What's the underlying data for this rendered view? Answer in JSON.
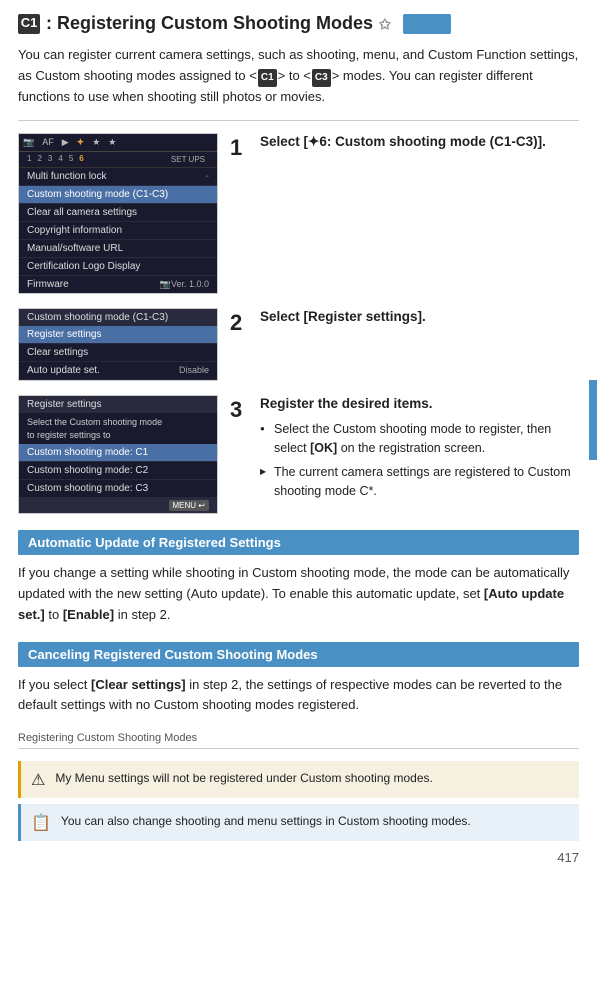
{
  "page": {
    "title_prefix": ": Registering Custom Shooting Modes",
    "title_star": "✩",
    "page_number": "417"
  },
  "intro": {
    "text": "You can register current camera settings, such as shooting, menu, and Custom Function settings, as Custom shooting modes assigned to <",
    "c1_label": "C1",
    "middle": "> to <",
    "c3_label": "C3",
    "end": "> modes. You can register different functions to use when shooting still photos or movies."
  },
  "steps": [
    {
      "number": "1",
      "title": "Select [✦6: Custom shooting mode (C1-C3)].",
      "has_desc": false
    },
    {
      "number": "2",
      "title": "Select [Register settings].",
      "has_desc": false
    },
    {
      "number": "3",
      "title": "Register the desired items.",
      "desc_bullets": [
        {
          "type": "bullet",
          "text": "Select the Custom shooting mode to register, then select [OK] on the registration screen."
        },
        {
          "type": "arrow",
          "text": "The current camera settings are registered to Custom shooting mode C*."
        }
      ]
    }
  ],
  "cam_screen_1": {
    "tabs": [
      "📷",
      "AF",
      "▶",
      "✦",
      "★",
      "★"
    ],
    "numbers": [
      "1",
      "2",
      "3",
      "4",
      "5",
      "6"
    ],
    "active_number": "6",
    "setup_label": "SET UPS",
    "items": [
      {
        "label": "Multi function lock",
        "value": "-",
        "highlighted": false
      },
      {
        "label": "Custom shooting mode (C1-C3)",
        "value": "",
        "highlighted": true
      },
      {
        "label": "Clear all camera settings",
        "value": "",
        "highlighted": false
      },
      {
        "label": "Copyright information",
        "value": "",
        "highlighted": false
      },
      {
        "label": "Manual/software URL",
        "value": "",
        "highlighted": false
      },
      {
        "label": "Certification Logo Display",
        "value": "",
        "highlighted": false
      },
      {
        "label": "Firmware",
        "value": "📷Ver. 1.0.0",
        "highlighted": false
      }
    ]
  },
  "cam_screen_2": {
    "header": "Custom shooting mode (C1-C3)",
    "items": [
      {
        "label": "Register settings",
        "value": "",
        "highlighted": true
      },
      {
        "label": "Clear settings",
        "value": "",
        "highlighted": false
      },
      {
        "label": "Auto update set.",
        "value": "Disable",
        "highlighted": false
      }
    ]
  },
  "cam_screen_3": {
    "header": "Register settings",
    "sub_desc": "Select the Custom shooting mode\nto register settings to",
    "items": [
      {
        "label": "Custom shooting mode: C1",
        "highlighted": true
      },
      {
        "label": "Custom shooting mode: C2",
        "highlighted": false
      },
      {
        "label": "Custom shooting mode: C3",
        "highlighted": false
      }
    ],
    "menu_label": "MENU"
  },
  "sections": [
    {
      "id": "auto-update",
      "header": "Automatic Update of Registered Settings",
      "text": "If you change a setting while shooting in Custom shooting mode, the mode can be automatically updated with the new setting (Auto update). To enable this automatic update, set [Auto update set.] to [Enable] in step 2.",
      "bold_parts": [
        "[Auto update set.]",
        "[Enable]"
      ]
    },
    {
      "id": "canceling",
      "header": "Canceling Registered Custom Shooting Modes",
      "text": "If you select [Clear settings] in step 2, the settings of respective modes can be reverted to the default settings with no Custom shooting modes registered.",
      "bold_parts": [
        "[Clear settings]"
      ]
    }
  ],
  "breadcrumb": "Registering Custom Shooting Modes",
  "notes": [
    {
      "type": "warning",
      "icon": "⚠",
      "text": "My Menu settings will not be registered under Custom shooting modes."
    },
    {
      "type": "info",
      "icon": "📋",
      "text": "You can also change shooting and menu settings in Custom shooting modes."
    }
  ]
}
